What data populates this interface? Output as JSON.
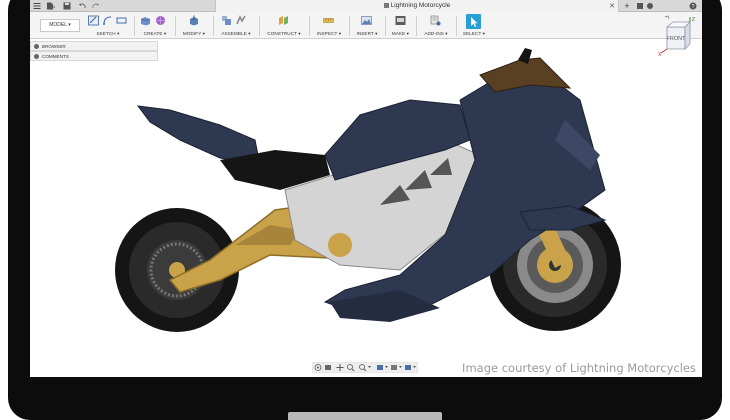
{
  "window": {
    "title": "Lightning Motorcycle"
  },
  "titlebar": {
    "new_tab_label": "+"
  },
  "ribbon": {
    "workspace_label": "MODEL ▾",
    "groups": [
      {
        "id": "sketch",
        "label": "SKETCH ▾"
      },
      {
        "id": "create",
        "label": "CREATE ▾"
      },
      {
        "id": "modify",
        "label": "MODIFY ▾"
      },
      {
        "id": "assemble",
        "label": "ASSEMBLE ▾"
      },
      {
        "id": "construct",
        "label": "CONSTRUCT ▾"
      },
      {
        "id": "inspect",
        "label": "INSPECT ▾"
      },
      {
        "id": "insert",
        "label": "INSERT ▾"
      },
      {
        "id": "make",
        "label": "MAKE ▾"
      },
      {
        "id": "addins",
        "label": "ADD-INS ▾"
      },
      {
        "id": "select",
        "label": "SELECT ▾"
      }
    ]
  },
  "browser_panel": {
    "browser_label": "BROWSER",
    "comments_label": "COMMENTS"
  },
  "viewcube": {
    "face_label": "FRONT",
    "axis_z": "Z",
    "axis_x": "X"
  },
  "viewport": {
    "credit": "Image courtesy of Lightning Motorcycles"
  },
  "colors": {
    "body": "#2e3850",
    "gold": "#c9a24a",
    "tire": "#1a1a1a",
    "accent_select": "#2a9fd6"
  }
}
